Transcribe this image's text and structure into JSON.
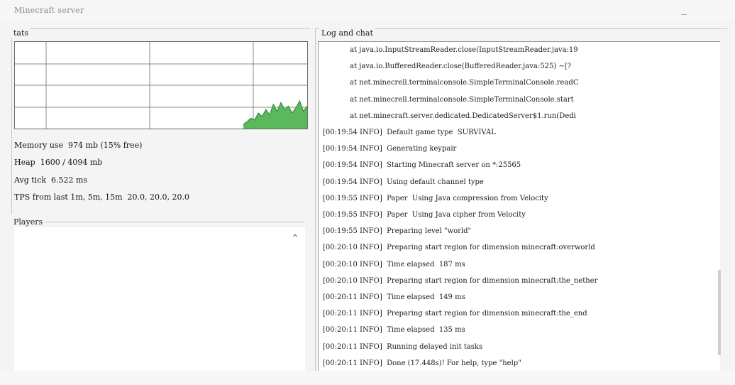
{
  "window": {
    "title": "Minecraft server",
    "minimize_label": "_"
  },
  "stats": {
    "legend": "tats",
    "graph": {
      "values": [
        0.05,
        0.08,
        0.12,
        0.1,
        0.18,
        0.14,
        0.22,
        0.16,
        0.28,
        0.2,
        0.3,
        0.22,
        0.26,
        0.18,
        0.24,
        0.32,
        0.2,
        0.26
      ],
      "fill_color": "#5cb85c",
      "line_color": "#2e7d32"
    },
    "memory": "Memory use  974 mb (15% free)",
    "heap": "Heap  1600 / 4094 mb",
    "avg_tick": "Avg tick  6.522 ms",
    "tps": "TPS from last 1m, 5m, 15m  20.0, 20.0, 20.0"
  },
  "players": {
    "legend": "Players",
    "scroll_up": "^"
  },
  "log": {
    "legend": "Log and chat",
    "lines": [
      "            at java.io.InputStreamReader.close(InputStreamReader.java:19",
      "            at java.io.BufferedReader.close(BufferedReader.java:525) ~[?",
      "            at net.minecrell.terminalconsole.SimpleTerminalConsole.readC",
      "            at net.minecrell.terminalconsole.SimpleTerminalConsole.start",
      "            at net.minecraft.server.dedicated.DedicatedServer$1.run(Dedi",
      "[00:19:54 INFO]  Default game type  SURVIVAL",
      "[00:19:54 INFO]  Generating keypair",
      "[00:19:54 INFO]  Starting Minecraft server on *:25565",
      "[00:19:54 INFO]  Using default channel type",
      "[00:19:55 INFO]  Paper  Using Java compression from Velocity",
      "[00:19:55 INFO]  Paper  Using Java cipher from Velocity",
      "[00:19:55 INFO]  Preparing level \"world\"",
      "[00:20:10 INFO]  Preparing start region for dimension minecraft:overworld",
      "[00:20:10 INFO]  Time elapsed  187 ms",
      "[00:20:10 INFO]  Preparing start region for dimension minecraft:the_nether",
      "[00:20:11 INFO]  Time elapsed  149 ms",
      "[00:20:11 INFO]  Preparing start region for dimension minecraft:the_end",
      "[00:20:11 INFO]  Time elapsed  135 ms",
      "[00:20:11 INFO]  Running delayed init tasks",
      "[00:20:11 INFO]  Done (17.448s)! For help, type \"help\""
    ]
  }
}
